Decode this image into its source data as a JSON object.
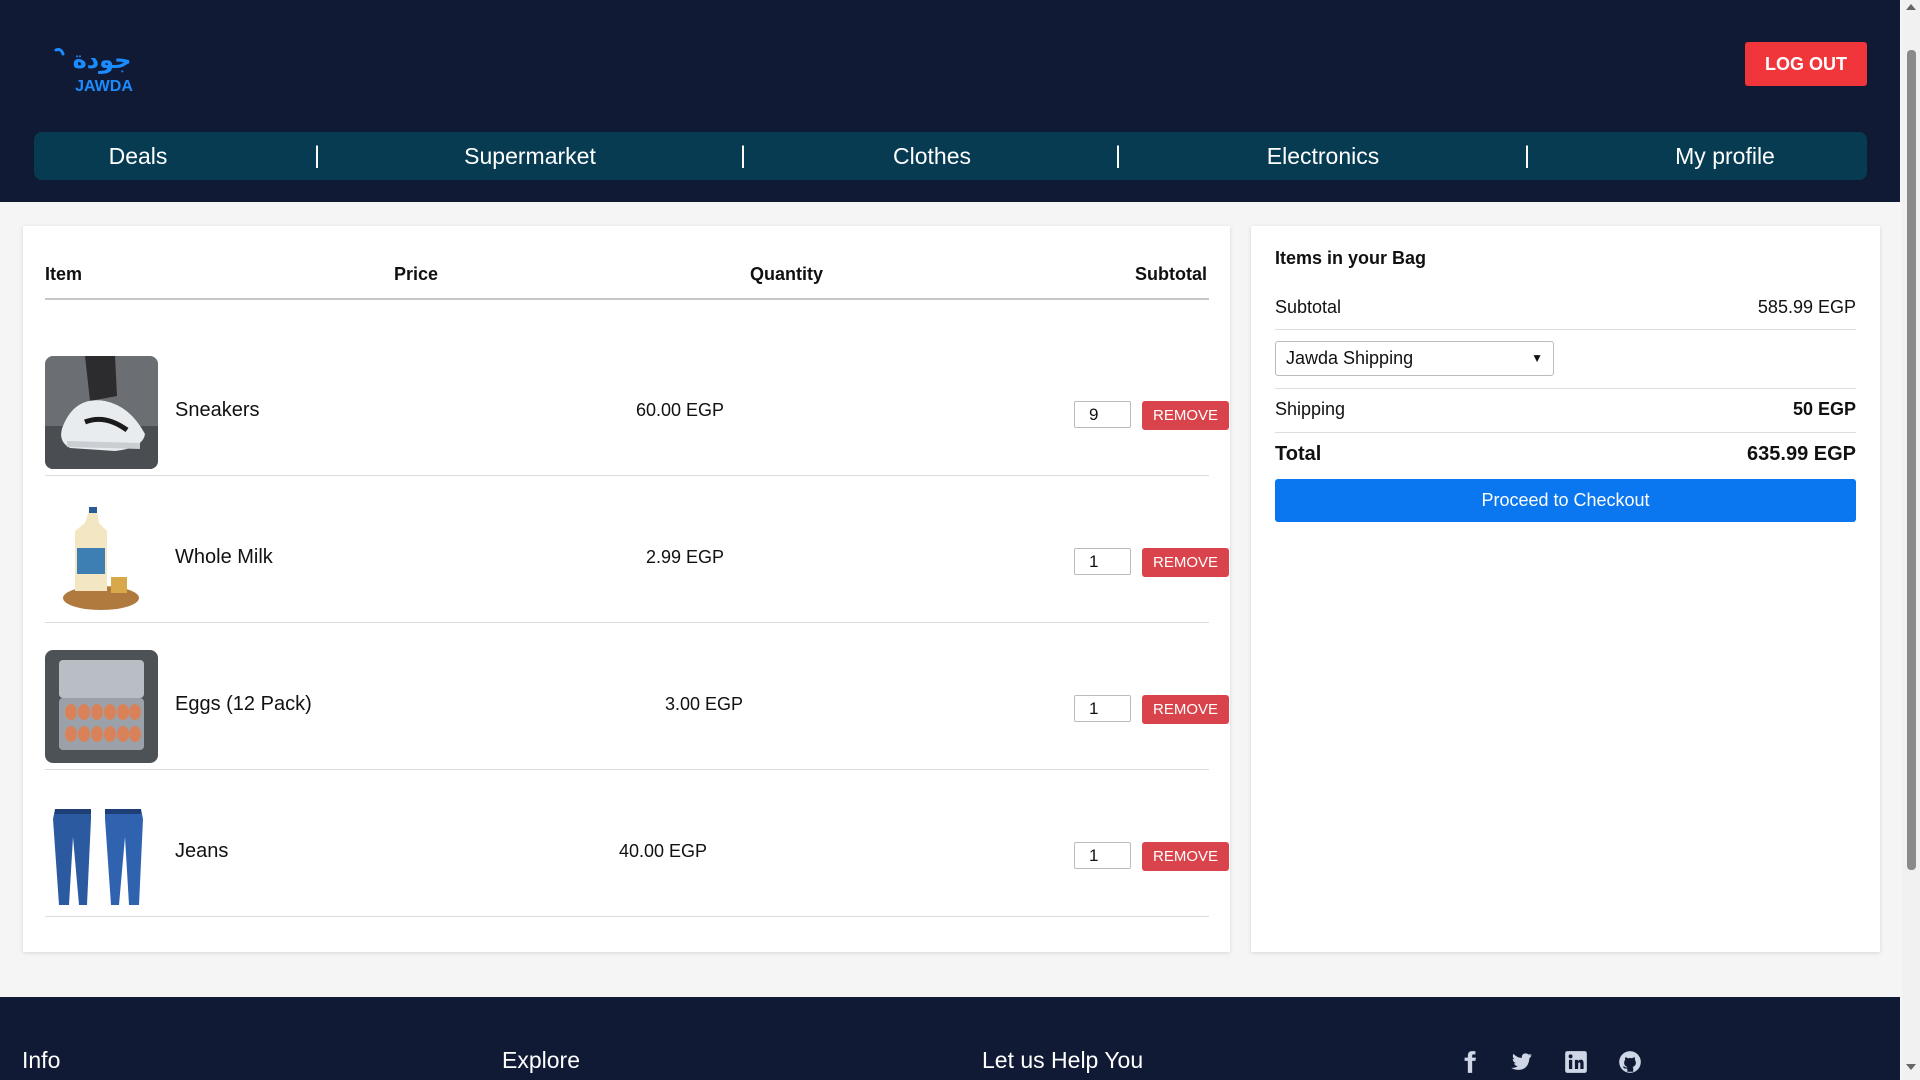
{
  "header": {
    "logo_arabic": "جودة",
    "logo_text": "JAWDA",
    "logout_label": "LOG OUT"
  },
  "nav": {
    "items": [
      "Deals",
      "Supermarket",
      "Clothes",
      "Electronics",
      "My profile"
    ],
    "separator": "|"
  },
  "cart": {
    "columns": [
      "Item",
      "Price",
      "Quantity",
      "Subtotal"
    ],
    "remove_label": "REMOVE",
    "items": [
      {
        "name": "Sneakers",
        "price": "60.00 EGP",
        "quantity": "9",
        "image": "sneakers-photo"
      },
      {
        "name": "Whole Milk",
        "price": "2.99 EGP",
        "quantity": "1",
        "image": "milk-bottle-photo"
      },
      {
        "name": "Eggs (12 Pack)",
        "price": "3.00 EGP",
        "quantity": "1",
        "image": "egg-carton-photo"
      },
      {
        "name": "Jeans",
        "price": "40.00 EGP",
        "quantity": "1",
        "image": "jeans-photo"
      }
    ]
  },
  "summary": {
    "title": "Items in your Bag",
    "subtotal_label": "Subtotal",
    "subtotal_value": "585.99 EGP",
    "shipping_option": "Jawda Shipping",
    "shipping_label": "Shipping",
    "shipping_value": "50 EGP",
    "total_label": "Total",
    "total_value": "635.99 EGP",
    "checkout_label": "Proceed to Checkout"
  },
  "footer": {
    "headings": [
      "Info",
      "Explore",
      "Let us Help You"
    ],
    "social_icons": [
      "facebook-icon",
      "twitter-icon",
      "linkedin-icon",
      "github-icon"
    ]
  },
  "colors": {
    "header_bg": "#111a35",
    "nav_bg": "#063b52",
    "logout_red": "#f0353b",
    "remove_red": "#d9434b",
    "checkout_blue": "#0a76f0",
    "logo_blue": "#1a8cff"
  }
}
